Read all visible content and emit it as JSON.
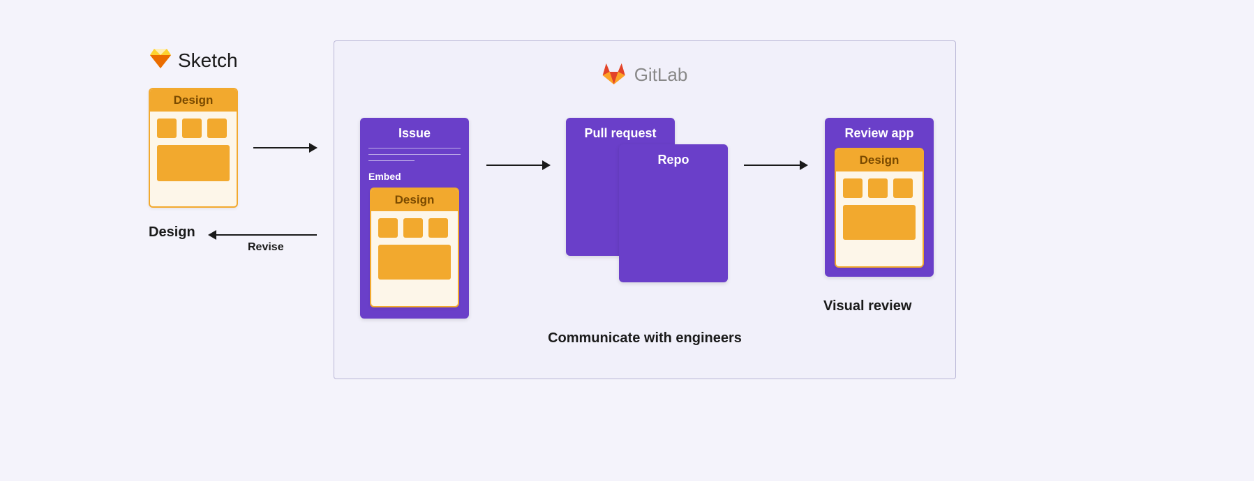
{
  "brands": {
    "sketch": "Sketch",
    "gitlab": "GitLab"
  },
  "cards": {
    "design_header": "Design",
    "issue_title": "Issue",
    "issue_embed": "Embed",
    "pr_title": "Pull request",
    "repo_title": "Repo",
    "review_title": "Review app"
  },
  "labels": {
    "design": "Design",
    "revise": "Revise",
    "communicate": "Communicate with engineers",
    "visual_review": "Visual review"
  },
  "colors": {
    "purple": "#6a3fc9",
    "orange": "#f2a92e",
    "cream": "#fdf6e9",
    "bg": "#f4f3fb"
  }
}
